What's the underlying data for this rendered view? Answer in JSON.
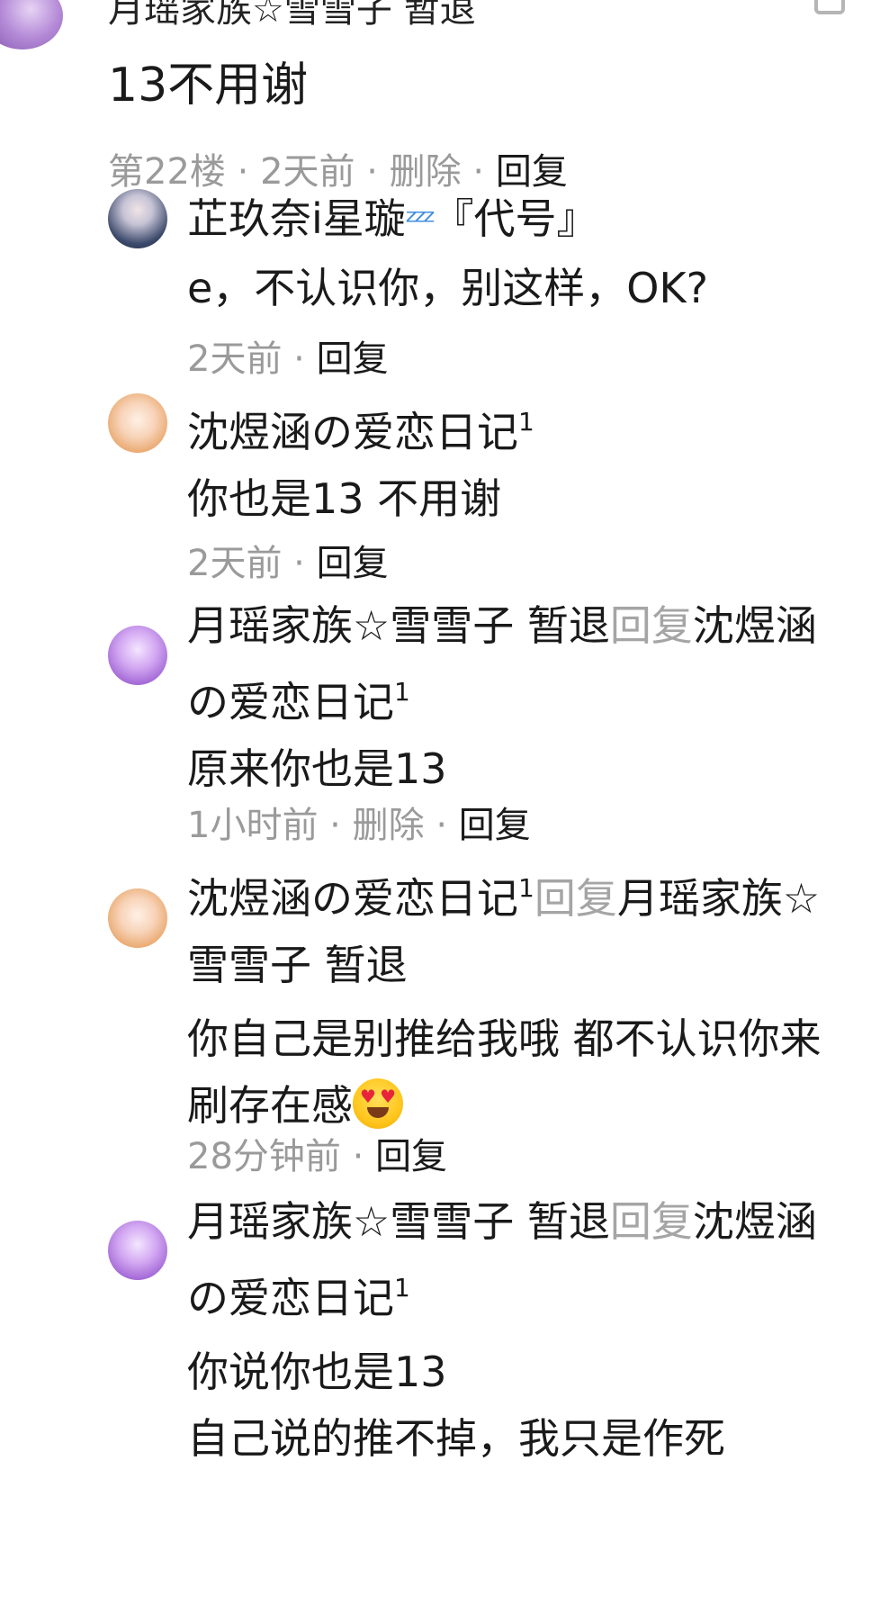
{
  "main_comment": {
    "author": "月瑶家族☆雪雪子 暂退",
    "content": "13不用谢",
    "floor": "第22楼",
    "time": "2天前",
    "delete_label": "删除",
    "reply_label": "回复",
    "separator": "·"
  },
  "replies": [
    {
      "author": "芷玖奈i星璇",
      "author_emoji": "💤",
      "author_suffix": "『代号』",
      "content": "e，不认识你，别这样，OK?",
      "time": "2天前",
      "reply_label": "回复",
      "avatar_style": "blue"
    },
    {
      "author": "沈煜涵の爱恋日记",
      "author_sup": "1",
      "content": "你也是13 不用谢",
      "time": "2天前",
      "reply_label": "回复",
      "avatar_style": "peach"
    },
    {
      "author": "月瑶家族☆雪雪子 暂退",
      "reply_word": "回复",
      "target": "沈煜涵の爱恋日记",
      "target_sup": "1",
      "content": "原来你也是13",
      "time": "1小时前",
      "delete_label": "删除",
      "reply_label": "回复",
      "avatar_style": "purple"
    },
    {
      "author": "沈煜涵の爱恋日记",
      "author_sup": "1",
      "reply_word": "回复",
      "target": "月瑶家族☆雪雪子 暂退",
      "content": "你自己是别推给我哦 都不认识你来刷存在感",
      "content_emoji": "heart-eyes-emoji",
      "time": "28分钟前",
      "reply_label": "回复",
      "avatar_style": "peach"
    },
    {
      "author": "月瑶家族☆雪雪子 暂退",
      "reply_word": "回复",
      "target": "沈煜涵の爱恋日记",
      "target_sup": "1",
      "content": "你说你也是13",
      "content_line2": "自己说的推不掉，我只是作死",
      "avatar_style": "purple"
    }
  ],
  "colors": {
    "text": "#1a1a1a",
    "meta": "#9a9a9a",
    "reply_word": "#a5a5a5",
    "background": "#ffffff"
  }
}
